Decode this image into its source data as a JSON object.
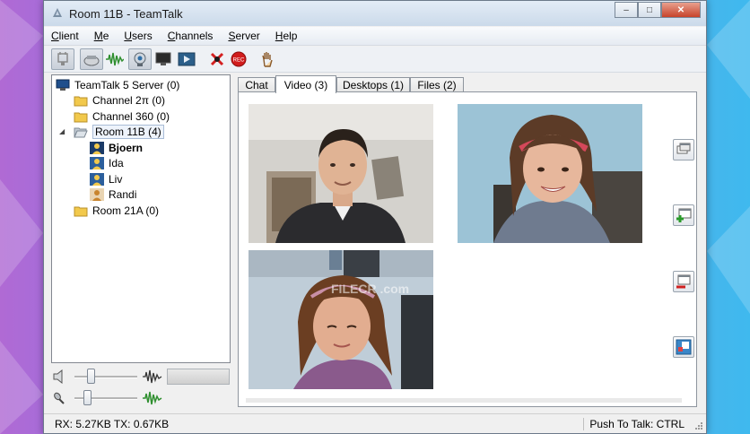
{
  "window": {
    "title": "Room 11B - TeamTalk",
    "controls": {
      "minimize": "‒",
      "maximize": "□",
      "close": "✕"
    }
  },
  "menu": [
    {
      "pre": "",
      "key": "C",
      "post": "lient"
    },
    {
      "pre": "",
      "key": "M",
      "post": "e"
    },
    {
      "pre": "",
      "key": "U",
      "post": "sers"
    },
    {
      "pre": "",
      "key": "C",
      "post": "hannels"
    },
    {
      "pre": "",
      "key": "S",
      "post": "erver"
    },
    {
      "pre": "",
      "key": "H",
      "post": "elp"
    }
  ],
  "toolbar": {
    "buttons": [
      {
        "icon": "connect-icon",
        "pressed": true
      },
      {
        "icon": "headset-icon",
        "pressed": true
      },
      {
        "icon": "voice-activation-icon",
        "pressed": false
      },
      {
        "icon": "webcam-icon",
        "pressed": true
      },
      {
        "icon": "desktop-share-icon",
        "pressed": false
      },
      {
        "icon": "media-stream-icon",
        "pressed": false
      },
      {
        "icon": "mute-all-icon",
        "pressed": false
      },
      {
        "icon": "record-icon",
        "pressed": false,
        "label": "REC"
      },
      {
        "icon": "raise-hand-icon",
        "pressed": false
      }
    ]
  },
  "tree": {
    "server": "TeamTalk 5 Server (0)",
    "channels": [
      {
        "name": "Channel 2π (0)",
        "expanded": false
      },
      {
        "name": "Channel 360 (0)",
        "expanded": false
      },
      {
        "name": "Room 11B (4)",
        "expanded": true,
        "selected": true,
        "users": [
          {
            "name": "Bjoern",
            "bold": true
          },
          {
            "name": "Ida",
            "bold": false
          },
          {
            "name": "Liv",
            "bold": false
          },
          {
            "name": "Randi",
            "bold": false
          }
        ]
      },
      {
        "name": "Room 21A (0)",
        "expanded": false
      }
    ]
  },
  "tabs": [
    {
      "label": "Chat",
      "active": false
    },
    {
      "label": "Video (3)",
      "active": true
    },
    {
      "label": "Desktops (1)",
      "active": false
    },
    {
      "label": "Files (2)",
      "active": false
    }
  ],
  "video_panel": {
    "streams": [
      "Bjoern",
      "Ida",
      "Liv"
    ],
    "watermark": "FILECR .com",
    "side_buttons": [
      "detach-video-icon",
      "add-video-icon",
      "remove-video-icon",
      "video-settings-icon"
    ]
  },
  "volume": {
    "master": {
      "icon": "speaker-icon",
      "level": 0.3
    },
    "mic": {
      "icon": "microphone-icon",
      "level": 0.25
    }
  },
  "status": {
    "traffic": "RX: 5.27KB TX: 0.67KB",
    "ptt": "Push To Talk: CTRL"
  },
  "colors": {
    "titlebar": "#cbdaea",
    "window_bg": "#f0f0f0",
    "close_button": "#c7432a",
    "record": "#d11c1c"
  }
}
